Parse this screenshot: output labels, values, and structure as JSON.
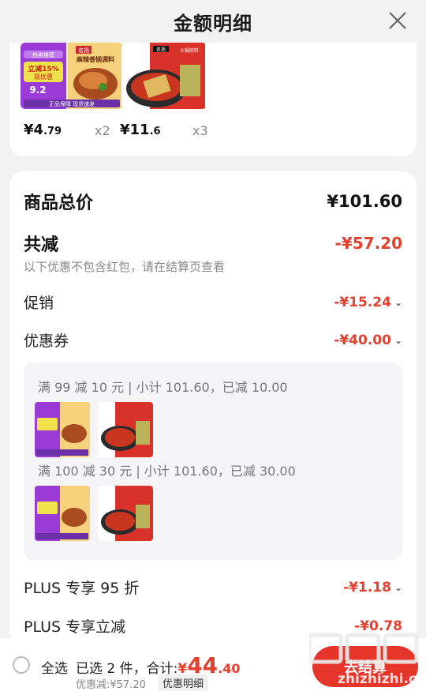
{
  "header": {
    "title": "金额明细"
  },
  "products": [
    {
      "price_int": "¥4",
      "price_dec": ".79",
      "qty": "x2"
    },
    {
      "price_int": "¥11",
      "price_dec": ".6",
      "qty": "x3"
    }
  ],
  "product_img_text": {
    "p1_badge_top": "热卖推荐",
    "p1_badge_main": "立减15%",
    "p1_badge_sub": "现优惠",
    "p1_price": "9.2",
    "p1_footer": "正品保障 现货速发",
    "p1_brand": "名扬",
    "p1_name": "麻辣香锅调料",
    "p2_brand": "名扬",
    "p2_name": "火锅底料"
  },
  "summary": {
    "total_label": "商品总价",
    "total_value": "¥101.60",
    "reduce_label": "共减",
    "reduce_value": "-¥57.20",
    "note": "以下优惠不包含红包，请在结算页查看",
    "promo_label": "促销",
    "promo_value": "-¥15.24",
    "coupon_label": "优惠券",
    "coupon_value": "-¥40.00",
    "coupon_rules": [
      {
        "text": "满 99 减 10 元 | 小计 101.60，已减 10.00"
      },
      {
        "text": "满 100 减 30 元 | 小计 101.60，已减 30.00"
      }
    ],
    "plus95_label": "PLUS 专享 95 折",
    "plus95_value": "-¥1.18",
    "plus_reduce_label": "PLUS 专享立减",
    "plus_reduce_value": "-¥0.78"
  },
  "bottom": {
    "select_all": "全选",
    "selected": "已选 2 件，合计:",
    "currency": "¥",
    "total_int": "44",
    "total_dec": ".40",
    "saved": "优惠减:¥57.20",
    "detail_link": "优惠明细",
    "checkout": "去结算"
  },
  "watermark": {
    "text": "zhizhizhi.com"
  },
  "colors": {
    "accent": "#e2412f",
    "button": "#e6352b"
  }
}
